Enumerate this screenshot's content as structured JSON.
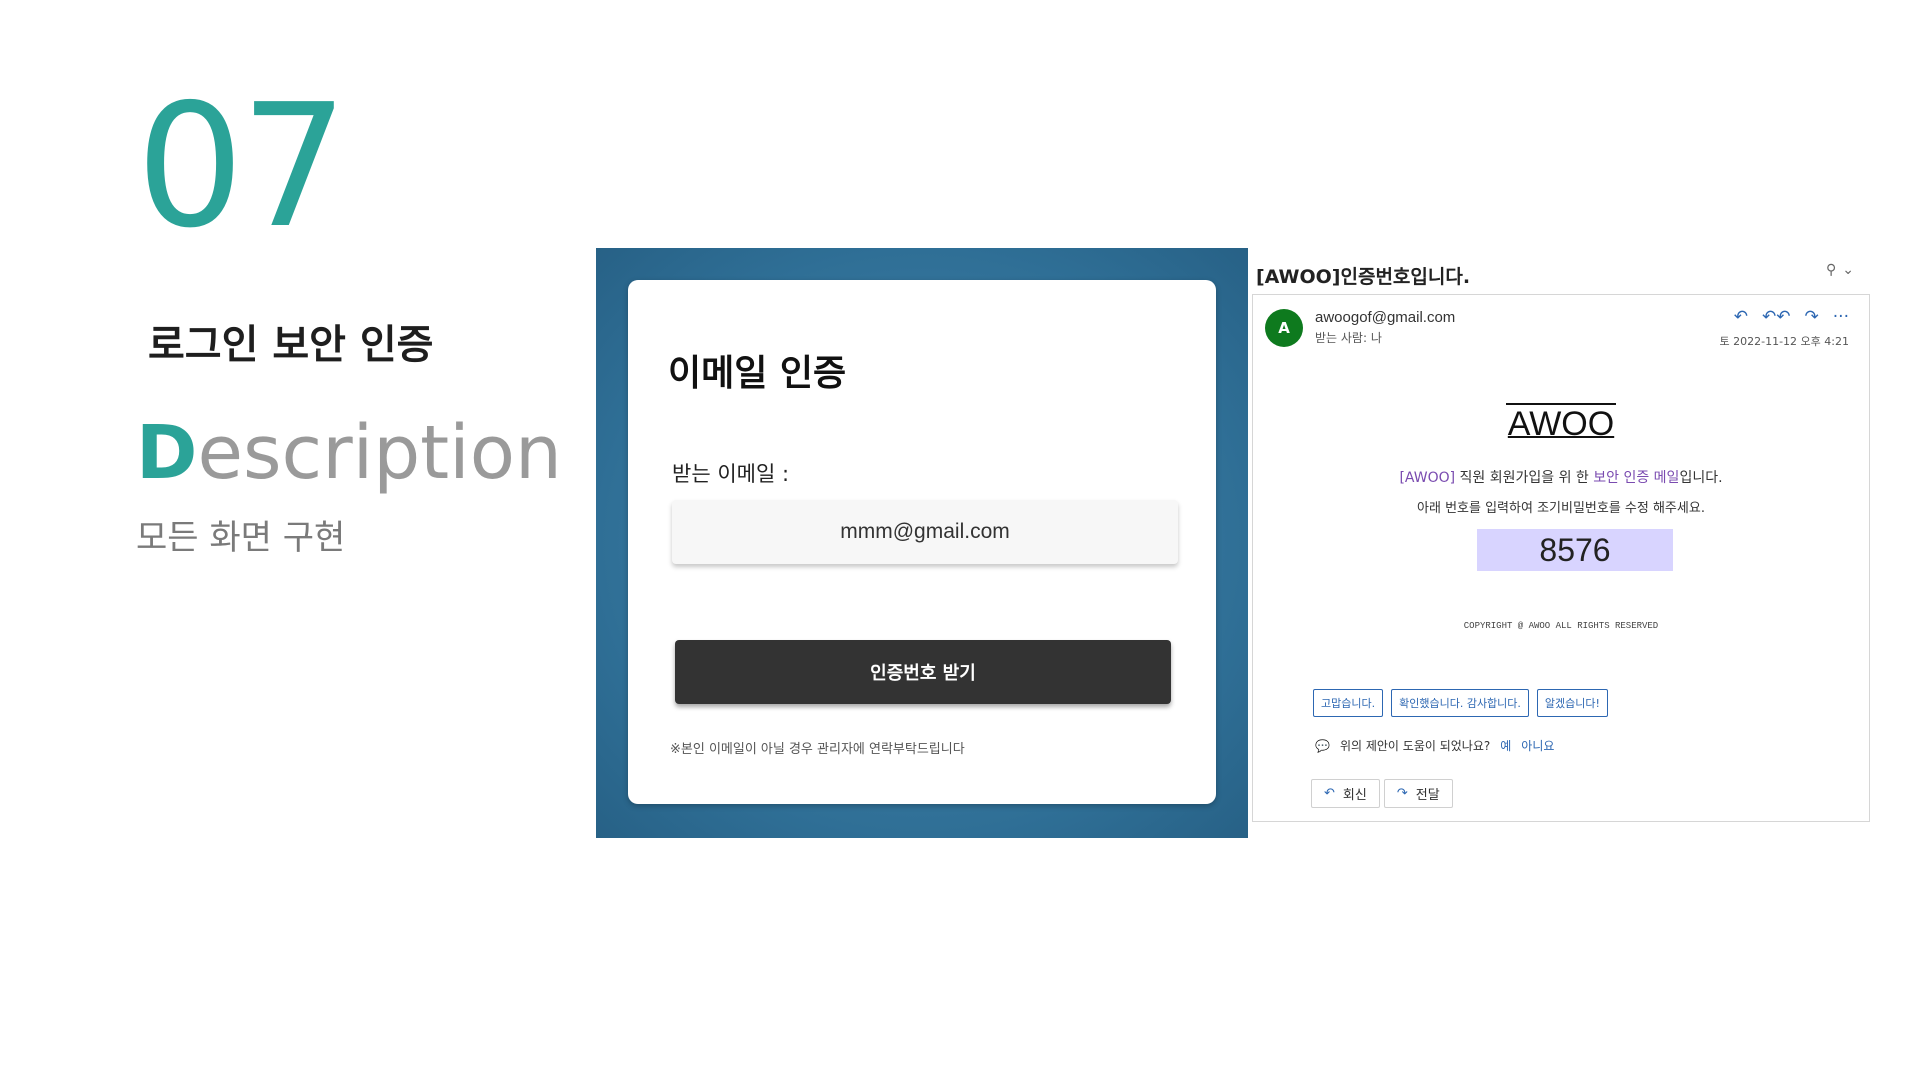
{
  "slide": {
    "number": "07",
    "title": "로그인 보안 인증",
    "desc_first_letter": "D",
    "desc_rest": "escription",
    "desc_sub": "모든 화면 구현"
  },
  "auth": {
    "title": "이메일 인증",
    "email_label": "받는 이메일 :",
    "email_value": "mmm@gmail.com",
    "button_label": "인증번호 받기",
    "note": "※본인 이메일이 아닐 경우 관리자에 연락부탁드립니다"
  },
  "mail": {
    "subject": "[AWOO]인증번호입니다.",
    "zoom_icon": "⚲",
    "zoom_caret": "⌄",
    "avatar_letter": "A",
    "sender": "awoogof@gmail.com",
    "recipient": "받는 사람: 나",
    "actions": {
      "reply": "↶",
      "reply_all": "↶↶",
      "forward": "↷",
      "more": "···"
    },
    "date": "토 2022-11-12 오후 4:21",
    "logo": "AWOO",
    "line1_hl": "[AWOO]",
    "line1_mid": " 직원 회원가입을 위 한 ",
    "line1_hl2": "보안 인증 메일",
    "line1_end": "입니다.",
    "line2": "아래  번호를 입력하여 조기비밀번호를 수정 해주세요.",
    "code": "8576",
    "copyright": "COPYRIGHT @ AWOO ALL RIGHTS RESERVED",
    "quick_replies": [
      "고맙습니다.",
      "확인했습니다. 감사합니다.",
      "알겠습니다!"
    ],
    "feedback_question": "위의 제안이 도움이 되었나요?",
    "feedback_yes": "예",
    "feedback_no": "아니요",
    "reply_label": "회신",
    "forward_label": "전달"
  }
}
